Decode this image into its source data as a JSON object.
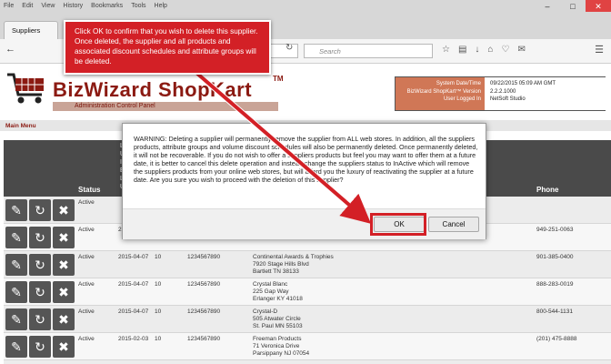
{
  "browser": {
    "menu": [
      "File",
      "Edit",
      "View",
      "History",
      "Bookmarks",
      "Tools",
      "Help"
    ],
    "tab_title": "Suppliers",
    "url_fragment": "n/su",
    "search_placeholder": "Search"
  },
  "header": {
    "logo_text": "BizWizard ShopKart",
    "logo_tm": "TM",
    "subtitle": "Administration Control Panel",
    "info_labels": [
      "System Date/Time",
      "BizWizard ShopKart™ Version",
      "User Logged In"
    ],
    "info_values": [
      "09/22/2015 05:09 AM GMT",
      "2.2.2.1000",
      "NetSoft Studio"
    ]
  },
  "main_menu_label": "Main Menu",
  "grid": {
    "status_header": "Status",
    "phone_header": "Phone",
    "vertical_header": [
      "L",
      "U",
      "I",
      "E",
      "L",
      "U"
    ],
    "rows": [
      {
        "status": "Active",
        "date": "",
        "num": "",
        "id": "",
        "address": [],
        "phone": ""
      },
      {
        "status": "Active",
        "date": "2",
        "num": "",
        "id": "",
        "address": [],
        "phone": "949-251-0063"
      },
      {
        "status": "Active",
        "date": "2015-04-07",
        "num": "10",
        "id": "1234567890",
        "address": [
          "Continental Awards & Trophies",
          "7920 Stage Hills Blvd",
          "Bartlett TN 38133"
        ],
        "phone": "901-385-0400"
      },
      {
        "status": "Active",
        "date": "2015-04-07",
        "num": "10",
        "id": "1234567890",
        "address": [
          "Crystal Blanc",
          "225 Gap Way",
          "Erlanger KY 41018"
        ],
        "phone": "888-283-0019"
      },
      {
        "status": "Active",
        "date": "2015-04-07",
        "num": "10",
        "id": "1234567890",
        "address": [
          "Crystal-D",
          "505 Atwater Circle",
          "St. Paul MN 55103"
        ],
        "phone": "800-544-1131"
      },
      {
        "status": "Active",
        "date": "2015-02-03",
        "num": "10",
        "id": "1234567890",
        "address": [
          "Freeman Products",
          "71 Veronica Drive",
          "Parsippany NJ 07054"
        ],
        "phone": "(201) 475-8888"
      }
    ]
  },
  "dialog": {
    "message": "WARNING:  Deleting a supplier will permanently remove the supplier from ALL web stores.  In addition, all the suppliers products, attribute groups and volume discount schedules will also be permanently deleted.  Once permanently deleted, it will not be recoverable.  If you do not wish to offer a suppliers products but feel you may want to offer them at a future date, it is better to cancel this delete operation and instead change the suppliers status to InActive which will remove the suppliers products from your online web stores, but will afford you the luxury of reactivating the supplier at a future date.  Are you sure you wish to proceed with the deletion of this supplier?",
    "ok_label": "OK",
    "cancel_label": "Cancel"
  },
  "callout": {
    "text": "Click OK to confirm that you wish to delete this supplier.  Once deleted, the supplier and all products and associated discount schedules and attribute groups will be deleted."
  },
  "colors": {
    "brand": "#8b1a12",
    "callout": "#d32026",
    "header_dark": "#4a4a4a",
    "info_box": "#d07756"
  }
}
